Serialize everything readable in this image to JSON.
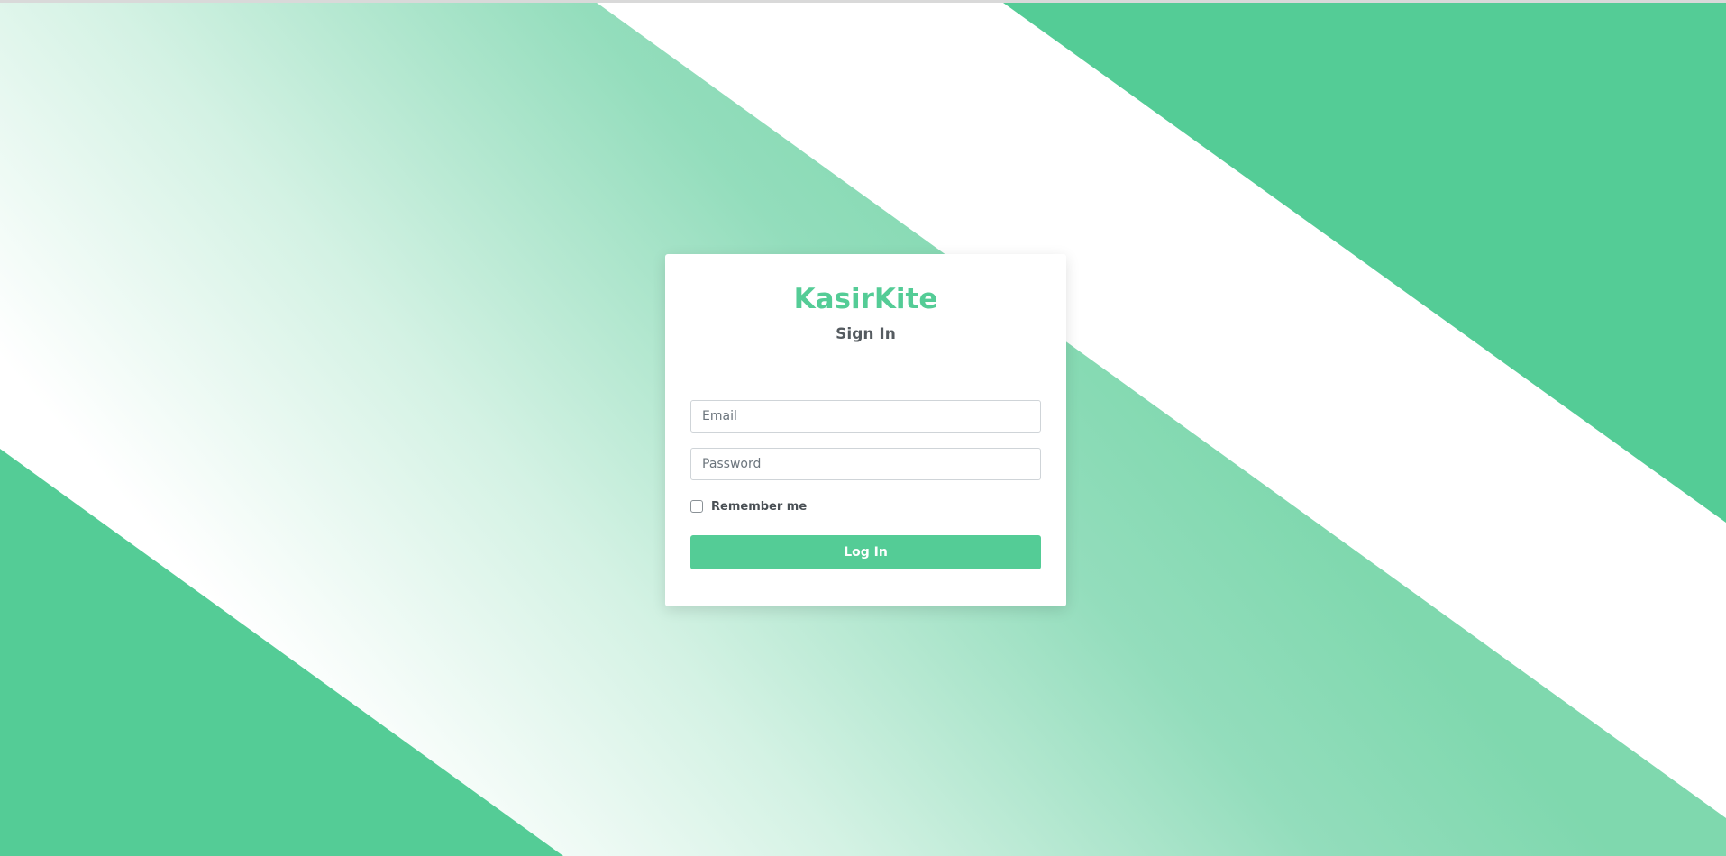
{
  "colors": {
    "accent": "#54cc96",
    "light_accent": "#e9f8f1",
    "white": "#ffffff"
  },
  "login": {
    "brand": "KasirKite",
    "title": "Sign In",
    "email_placeholder": "Email",
    "email_value": "",
    "password_placeholder": "Password",
    "password_value": "",
    "remember_label": "Remember me",
    "remember_checked": false,
    "submit_label": "Log In"
  }
}
